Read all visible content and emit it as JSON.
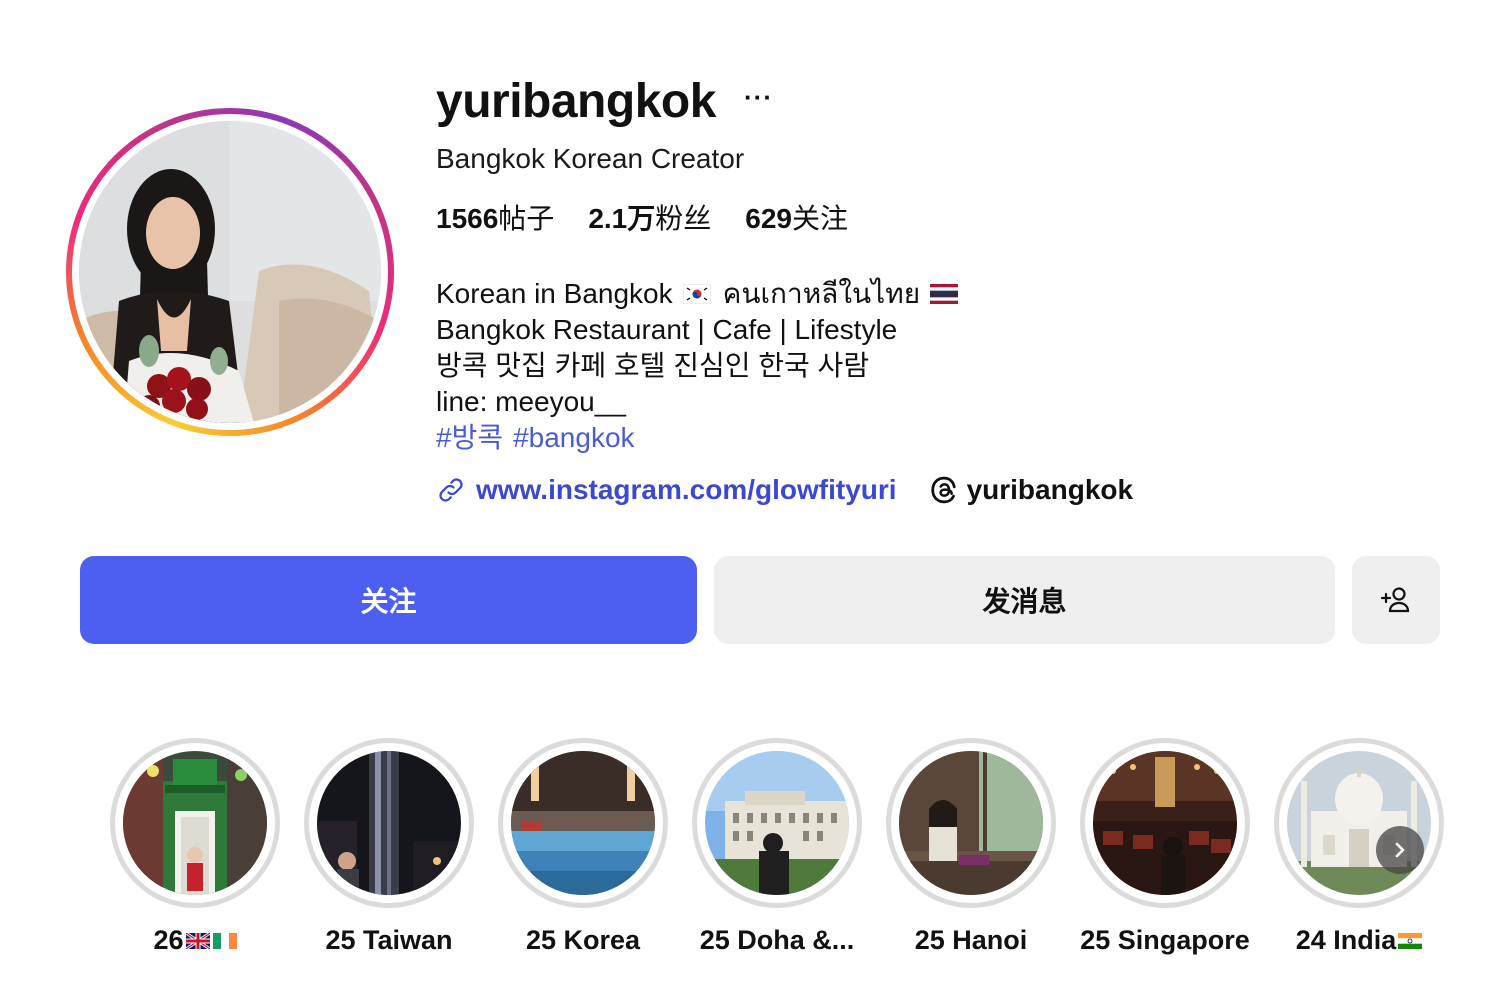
{
  "profile": {
    "username": "yuribangkok",
    "more_label": "···",
    "category": "Bangkok Korean Creator"
  },
  "stats": {
    "posts_count": "1566",
    "posts_label": "帖子",
    "followers_count": "2.1万",
    "followers_label": "粉丝",
    "following_count": "629",
    "following_label": "关注"
  },
  "bio": {
    "line1_a": "Korean in Bangkok",
    "line1_b": "คนเกาหลีในไทย",
    "line2": "Bangkok Restaurant | Cafe | Lifestyle",
    "line3": "방콕 맛집 카페 호텔 진심인 한국 사람",
    "line4": "line: meeyou__",
    "hashtag1": "#방콕",
    "hashtag2": "#bangkok"
  },
  "links": {
    "website": "www.instagram.com/glowfityuri",
    "threads": "yuribangkok"
  },
  "actions": {
    "follow": "关注",
    "message": "发消息"
  },
  "highlights": [
    {
      "label": "26"
    },
    {
      "label": "25 Taiwan"
    },
    {
      "label": "25 Korea"
    },
    {
      "label": "25 Doha &..."
    },
    {
      "label": "25 Hanoi"
    },
    {
      "label": "25 Singapore"
    },
    {
      "label": "24 India"
    }
  ],
  "colors": {
    "follow_button": "#4d5ff0",
    "secondary_button": "#efefef",
    "link": "#3b48d0",
    "hashtag": "#4a5bd8",
    "highlight_ring": "#dbdbdb"
  },
  "icons": {
    "link": "link-icon",
    "threads": "threads-icon",
    "add_person": "add-person-icon",
    "next": "chevron-right-icon",
    "more": "more-icon"
  }
}
